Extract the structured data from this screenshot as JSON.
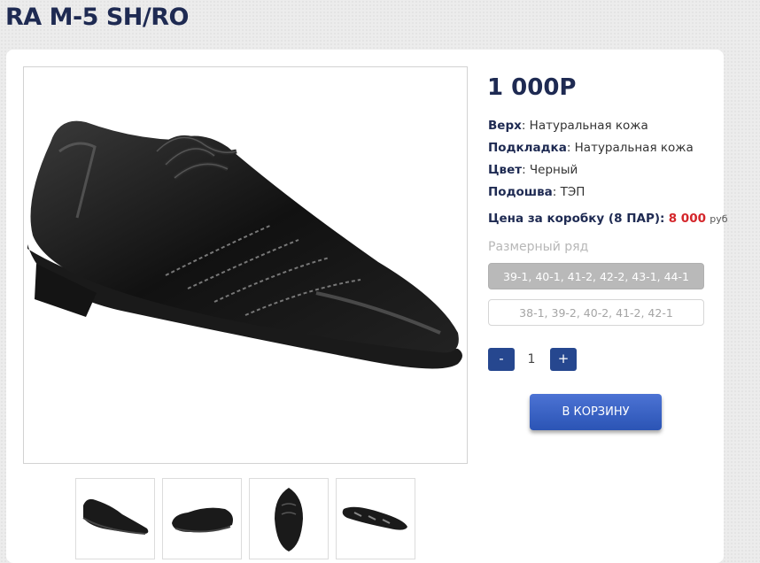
{
  "product": {
    "title": "RA M-5 SH/RO",
    "price": "1 000Р",
    "specs": [
      {
        "label": "Верх",
        "value": ": Натуральная кожа"
      },
      {
        "label": "Подкладка",
        "value": ": Натуральная кожа"
      },
      {
        "label": "Цвет",
        "value": ": Черный"
      },
      {
        "label": "Подошва",
        "value": ": ТЭП"
      }
    ],
    "box_price": {
      "label": "Цена за коробку (8 ПАР):",
      "amount": "8 000",
      "currency": "руб"
    }
  },
  "sizes": {
    "heading": "Размерный ряд",
    "options": [
      "39-1, 40-1, 41-2, 42-2, 43-1, 44-1",
      "38-1, 39-2, 40-2, 41-2, 42-1"
    ],
    "selected": "39-1, 40-1, 41-2, 42-2, 43-1, 44-1"
  },
  "quantity": {
    "minus": "-",
    "plus": "+",
    "value": "1"
  },
  "cart_button": "В КОРЗИНУ",
  "colors": {
    "accent": "#26478f",
    "title": "#1e2a52",
    "price_red": "#d4262b",
    "selected_size": "#b9b9b9"
  },
  "thumbnails": [
    "shoe-side-view",
    "shoe-angled-view",
    "shoe-top-view",
    "shoe-sole-view"
  ]
}
